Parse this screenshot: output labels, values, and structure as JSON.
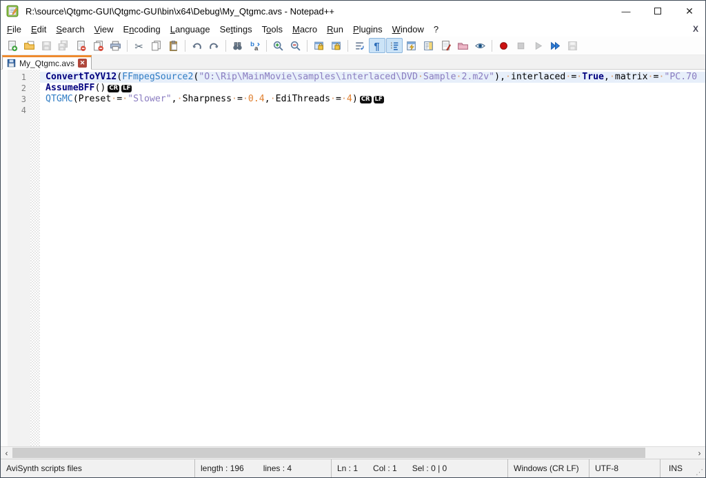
{
  "window": {
    "title": "R:\\source\\Qtgmc-GUI\\Qtgmc-GUI\\bin\\x64\\Debug\\My_Qtgmc.avs - Notepad++",
    "controls": {
      "minimize": "—",
      "close": "✕"
    }
  },
  "menu": {
    "items": [
      {
        "label": "File",
        "u": 0
      },
      {
        "label": "Edit",
        "u": 0
      },
      {
        "label": "Search",
        "u": 0
      },
      {
        "label": "View",
        "u": 0
      },
      {
        "label": "Encoding",
        "u": 1
      },
      {
        "label": "Language",
        "u": 0
      },
      {
        "label": "Settings",
        "u": 2
      },
      {
        "label": "Tools",
        "u": 1
      },
      {
        "label": "Macro",
        "u": 0
      },
      {
        "label": "Run",
        "u": 0
      },
      {
        "label": "Plugins",
        "u": 0
      },
      {
        "label": "Window",
        "u": 0
      },
      {
        "label": "?",
        "u": -1
      }
    ],
    "close_label": "X"
  },
  "toolbar": {
    "buttons": [
      {
        "name": "new-file"
      },
      {
        "name": "open-file"
      },
      {
        "name": "save-file",
        "disabled": true
      },
      {
        "name": "save-all",
        "disabled": true
      },
      {
        "name": "close-file"
      },
      {
        "name": "close-all"
      },
      {
        "name": "print"
      },
      {
        "name": "cut",
        "sep": true
      },
      {
        "name": "copy"
      },
      {
        "name": "paste"
      },
      {
        "name": "undo",
        "sep": true
      },
      {
        "name": "redo"
      },
      {
        "name": "find",
        "sep": true
      },
      {
        "name": "replace"
      },
      {
        "name": "zoom-in",
        "sep": true
      },
      {
        "name": "zoom-out"
      },
      {
        "name": "sync-vertical",
        "sep": true
      },
      {
        "name": "sync-horizontal"
      },
      {
        "name": "word-wrap",
        "sep": true
      },
      {
        "name": "show-all-characters",
        "active": true
      },
      {
        "name": "show-indent-guide",
        "active": true
      },
      {
        "name": "function-list"
      },
      {
        "name": "document-map"
      },
      {
        "name": "document-list"
      },
      {
        "name": "folder-as-workspace"
      },
      {
        "name": "monitoring"
      },
      {
        "name": "macro-record",
        "sep": true
      },
      {
        "name": "macro-stop",
        "disabled": true
      },
      {
        "name": "macro-playback",
        "disabled": true
      },
      {
        "name": "macro-run-multiple"
      },
      {
        "name": "macro-save",
        "disabled": true
      }
    ]
  },
  "tabs": [
    {
      "label": "My_Qtgmc.avs",
      "active": true,
      "saved": true,
      "close_glyph": "✕"
    }
  ],
  "editor": {
    "colors": {
      "keyword": "#00007f",
      "function": "#2f7cc4",
      "string": "#8a7cc0",
      "number": "#e08030",
      "whitespace": "#dc9a68",
      "current_line": "#e7effa",
      "line_number": "#808080",
      "accent": "#ee8a2e"
    },
    "lines": [
      {
        "num": "1",
        "current": true,
        "tokens": [
          {
            "c": "kw",
            "t": "ConvertToYV12"
          },
          {
            "c": "def",
            "t": "("
          },
          {
            "c": "fn",
            "t": "FFmpegSource2"
          },
          {
            "c": "def",
            "t": "("
          },
          {
            "c": "str",
            "t": "\"O:\\Rip\\MainMovie\\samples\\interlaced\\DVD"
          },
          {
            "c": "ws",
            "t": "·"
          },
          {
            "c": "str",
            "t": "Sample"
          },
          {
            "c": "ws",
            "t": "·"
          },
          {
            "c": "str",
            "t": "2.m2v\""
          },
          {
            "c": "def",
            "t": "),"
          },
          {
            "c": "ws",
            "t": "·"
          },
          {
            "c": "def",
            "t": "interlaced"
          },
          {
            "c": "ws",
            "t": "·"
          },
          {
            "c": "def",
            "t": "="
          },
          {
            "c": "ws",
            "t": "·"
          },
          {
            "c": "kw",
            "t": "True"
          },
          {
            "c": "def",
            "t": ","
          },
          {
            "c": "ws",
            "t": "·"
          },
          {
            "c": "def",
            "t": "matrix"
          },
          {
            "c": "ws",
            "t": "·"
          },
          {
            "c": "def",
            "t": "="
          },
          {
            "c": "ws",
            "t": "·"
          },
          {
            "c": "str",
            "t": "\"PC.70"
          }
        ]
      },
      {
        "num": "2",
        "tokens": [
          {
            "c": "kw",
            "t": "AssumeBFF"
          },
          {
            "c": "def",
            "t": "()"
          },
          {
            "c": "eol",
            "t": "CR"
          },
          {
            "c": "eol",
            "t": "LF"
          }
        ]
      },
      {
        "num": "3",
        "tokens": [
          {
            "c": "fn",
            "t": "QTGMC"
          },
          {
            "c": "def",
            "t": "(Preset"
          },
          {
            "c": "ws",
            "t": "·"
          },
          {
            "c": "def",
            "t": "="
          },
          {
            "c": "ws",
            "t": "·"
          },
          {
            "c": "str",
            "t": "\"Slower\""
          },
          {
            "c": "def",
            "t": ","
          },
          {
            "c": "ws",
            "t": "·"
          },
          {
            "c": "def",
            "t": "Sharpness"
          },
          {
            "c": "ws",
            "t": "·"
          },
          {
            "c": "def",
            "t": "="
          },
          {
            "c": "ws",
            "t": "·"
          },
          {
            "c": "num",
            "t": "0.4"
          },
          {
            "c": "def",
            "t": ","
          },
          {
            "c": "ws",
            "t": "·"
          },
          {
            "c": "def",
            "t": "EdiThreads"
          },
          {
            "c": "ws",
            "t": "·"
          },
          {
            "c": "def",
            "t": "="
          },
          {
            "c": "ws",
            "t": "·"
          },
          {
            "c": "num",
            "t": "4"
          },
          {
            "c": "def",
            "t": ")"
          },
          {
            "c": "eol",
            "t": "CR"
          },
          {
            "c": "eol",
            "t": "LF"
          }
        ]
      },
      {
        "num": "4",
        "tokens": []
      }
    ]
  },
  "scrollbar": {
    "left_arrow": "‹",
    "right_arrow": "›"
  },
  "statusbar": {
    "doctype": "AviSynth scripts files",
    "length": "length : 196",
    "lines": "lines : 4",
    "ln": "Ln : 1",
    "col": "Col : 1",
    "sel": "Sel : 0 | 0",
    "eol": "Windows (CR LF)",
    "encoding": "UTF-8",
    "mode": "INS",
    "grip": "⋰"
  }
}
